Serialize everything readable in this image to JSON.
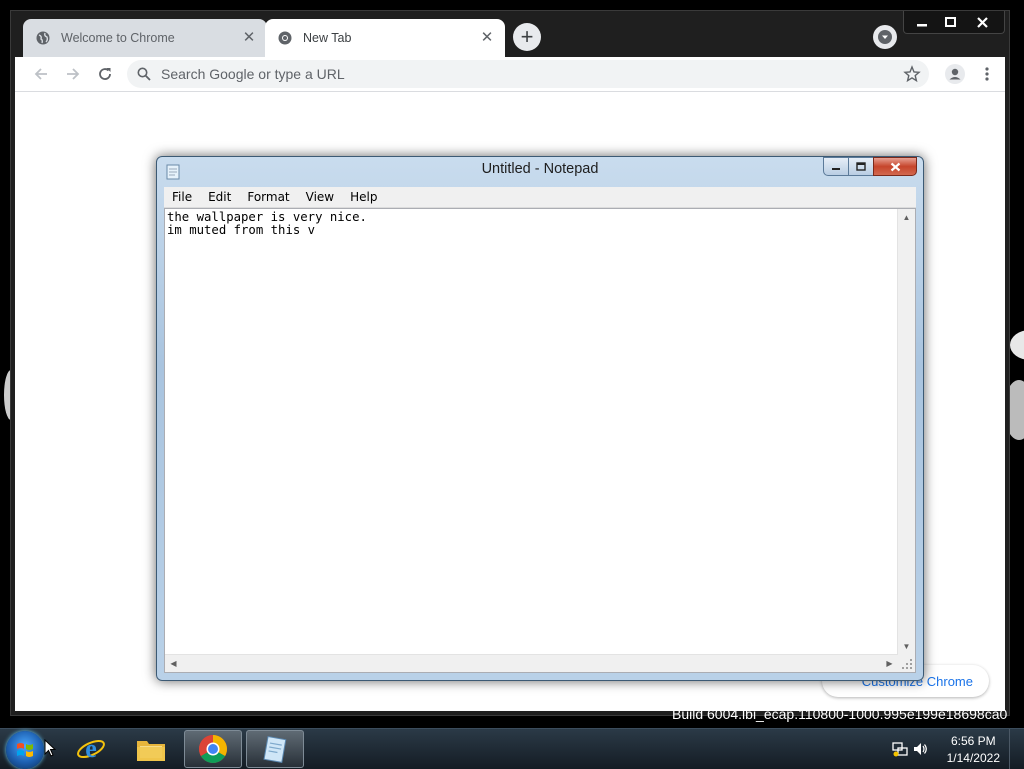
{
  "browser": {
    "tabs": [
      {
        "title": "Welcome to Chrome",
        "icon": "globe-icon",
        "active": false
      },
      {
        "title": "New Tab",
        "icon": "chrome-icon",
        "active": true
      }
    ],
    "omnibox_placeholder": "Search Google or type a URL",
    "customize_button": "Customize Chrome"
  },
  "build_watermark": "Build 6004.lbi_ecap.110800-1000.995e199e18698ca0",
  "notepad": {
    "title": "Untitled - Notepad",
    "menu": [
      "File",
      "Edit",
      "Format",
      "View",
      "Help"
    ],
    "content": "the wallpaper is very nice.\nim muted from this v"
  },
  "taskbar": {
    "items": [
      "start-button",
      "internet-explorer",
      "windows-explorer",
      "google-chrome",
      "notepad"
    ],
    "clock_time": "6:56 PM",
    "clock_date": "1/14/2022"
  },
  "colors": {
    "chrome_frame": "#1f1f1f",
    "notepad_frame": "#b9d1e8",
    "taskbar": "#1c2630",
    "link_blue": "#1a73e8"
  }
}
